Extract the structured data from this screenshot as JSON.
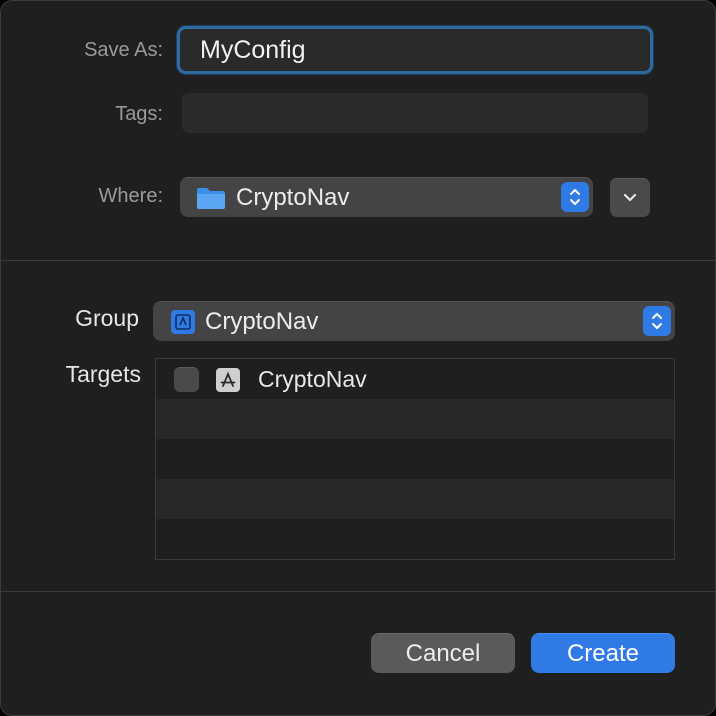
{
  "save": {
    "save_as_label": "Save As:",
    "filename": "MyConfig",
    "tags_label": "Tags:",
    "tags_value": "",
    "where_label": "Where:",
    "where_value": "CryptoNav"
  },
  "group": {
    "label": "Group",
    "value": "CryptoNav"
  },
  "targets": {
    "label": "Targets",
    "items": [
      {
        "name": "CryptoNav",
        "checked": false,
        "icon": "app-target-icon"
      }
    ]
  },
  "buttons": {
    "cancel": "Cancel",
    "create": "Create"
  },
  "colors": {
    "accent": "#2f7ae5",
    "focus_ring": "#2f6aa0",
    "background": "#1f1f1f"
  }
}
